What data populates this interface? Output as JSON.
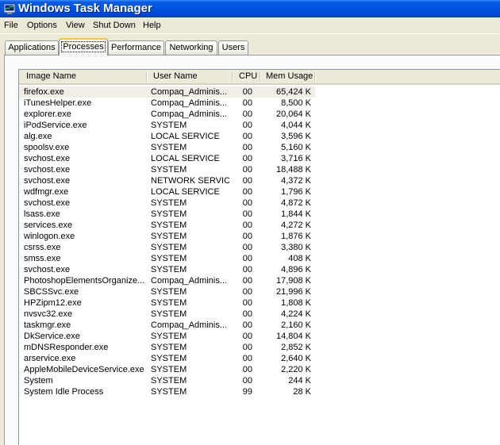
{
  "window": {
    "title": "Windows Task Manager"
  },
  "menu": [
    "File",
    "Options",
    "View",
    "Shut Down",
    "Help"
  ],
  "tabs": [
    "Applications",
    "Processes",
    "Performance",
    "Networking",
    "Users"
  ],
  "active_tab": "Processes",
  "columns": {
    "image_name": "Image Name",
    "user_name": "User Name",
    "cpu": "CPU",
    "mem_usage": "Mem Usage"
  },
  "processes": [
    {
      "name": "firefox.exe",
      "user": "Compaq_Adminis...",
      "cpu": "00",
      "mem": "65,424 K"
    },
    {
      "name": "iTunesHelper.exe",
      "user": "Compaq_Adminis...",
      "cpu": "00",
      "mem": "8,500 K"
    },
    {
      "name": "explorer.exe",
      "user": "Compaq_Adminis...",
      "cpu": "00",
      "mem": "20,064 K"
    },
    {
      "name": "iPodService.exe",
      "user": "SYSTEM",
      "cpu": "00",
      "mem": "4,044 K"
    },
    {
      "name": "alg.exe",
      "user": "LOCAL SERVICE",
      "cpu": "00",
      "mem": "3,596 K"
    },
    {
      "name": "spoolsv.exe",
      "user": "SYSTEM",
      "cpu": "00",
      "mem": "5,160 K"
    },
    {
      "name": "svchost.exe",
      "user": "LOCAL SERVICE",
      "cpu": "00",
      "mem": "3,716 K"
    },
    {
      "name": "svchost.exe",
      "user": "SYSTEM",
      "cpu": "00",
      "mem": "18,488 K"
    },
    {
      "name": "svchost.exe",
      "user": "NETWORK SERVICE",
      "cpu": "00",
      "mem": "4,372 K"
    },
    {
      "name": "wdfmgr.exe",
      "user": "LOCAL SERVICE",
      "cpu": "00",
      "mem": "1,796 K"
    },
    {
      "name": "svchost.exe",
      "user": "SYSTEM",
      "cpu": "00",
      "mem": "4,872 K"
    },
    {
      "name": "lsass.exe",
      "user": "SYSTEM",
      "cpu": "00",
      "mem": "1,844 K"
    },
    {
      "name": "services.exe",
      "user": "SYSTEM",
      "cpu": "00",
      "mem": "4,272 K"
    },
    {
      "name": "winlogon.exe",
      "user": "SYSTEM",
      "cpu": "00",
      "mem": "1,876 K"
    },
    {
      "name": "csrss.exe",
      "user": "SYSTEM",
      "cpu": "00",
      "mem": "3,380 K"
    },
    {
      "name": "smss.exe",
      "user": "SYSTEM",
      "cpu": "00",
      "mem": "408 K"
    },
    {
      "name": "svchost.exe",
      "user": "SYSTEM",
      "cpu": "00",
      "mem": "4,896 K"
    },
    {
      "name": "PhotoshopElementsOrganize...",
      "user": "Compaq_Adminis...",
      "cpu": "00",
      "mem": "17,908 K"
    },
    {
      "name": "SBCSSvc.exe",
      "user": "SYSTEM",
      "cpu": "00",
      "mem": "21,996 K"
    },
    {
      "name": "HPZipm12.exe",
      "user": "SYSTEM",
      "cpu": "00",
      "mem": "1,808 K"
    },
    {
      "name": "nvsvc32.exe",
      "user": "SYSTEM",
      "cpu": "00",
      "mem": "4,224 K"
    },
    {
      "name": "taskmgr.exe",
      "user": "Compaq_Adminis...",
      "cpu": "00",
      "mem": "2,160 K"
    },
    {
      "name": "DkService.exe",
      "user": "SYSTEM",
      "cpu": "00",
      "mem": "14,804 K"
    },
    {
      "name": "mDNSResponder.exe",
      "user": "SYSTEM",
      "cpu": "00",
      "mem": "2,852 K"
    },
    {
      "name": "arservice.exe",
      "user": "SYSTEM",
      "cpu": "00",
      "mem": "2,640 K"
    },
    {
      "name": "AppleMobileDeviceService.exe",
      "user": "SYSTEM",
      "cpu": "00",
      "mem": "2,220 K"
    },
    {
      "name": "System",
      "user": "SYSTEM",
      "cpu": "00",
      "mem": "244 K"
    },
    {
      "name": "System Idle Process",
      "user": "SYSTEM",
      "cpu": "99",
      "mem": "28 K"
    }
  ],
  "colors": {
    "title_bar": "#0054e3",
    "selected_row": "#f0eee6",
    "active_tab_accent": "#ffc83c"
  },
  "icons": {
    "app": "task-manager-icon"
  }
}
